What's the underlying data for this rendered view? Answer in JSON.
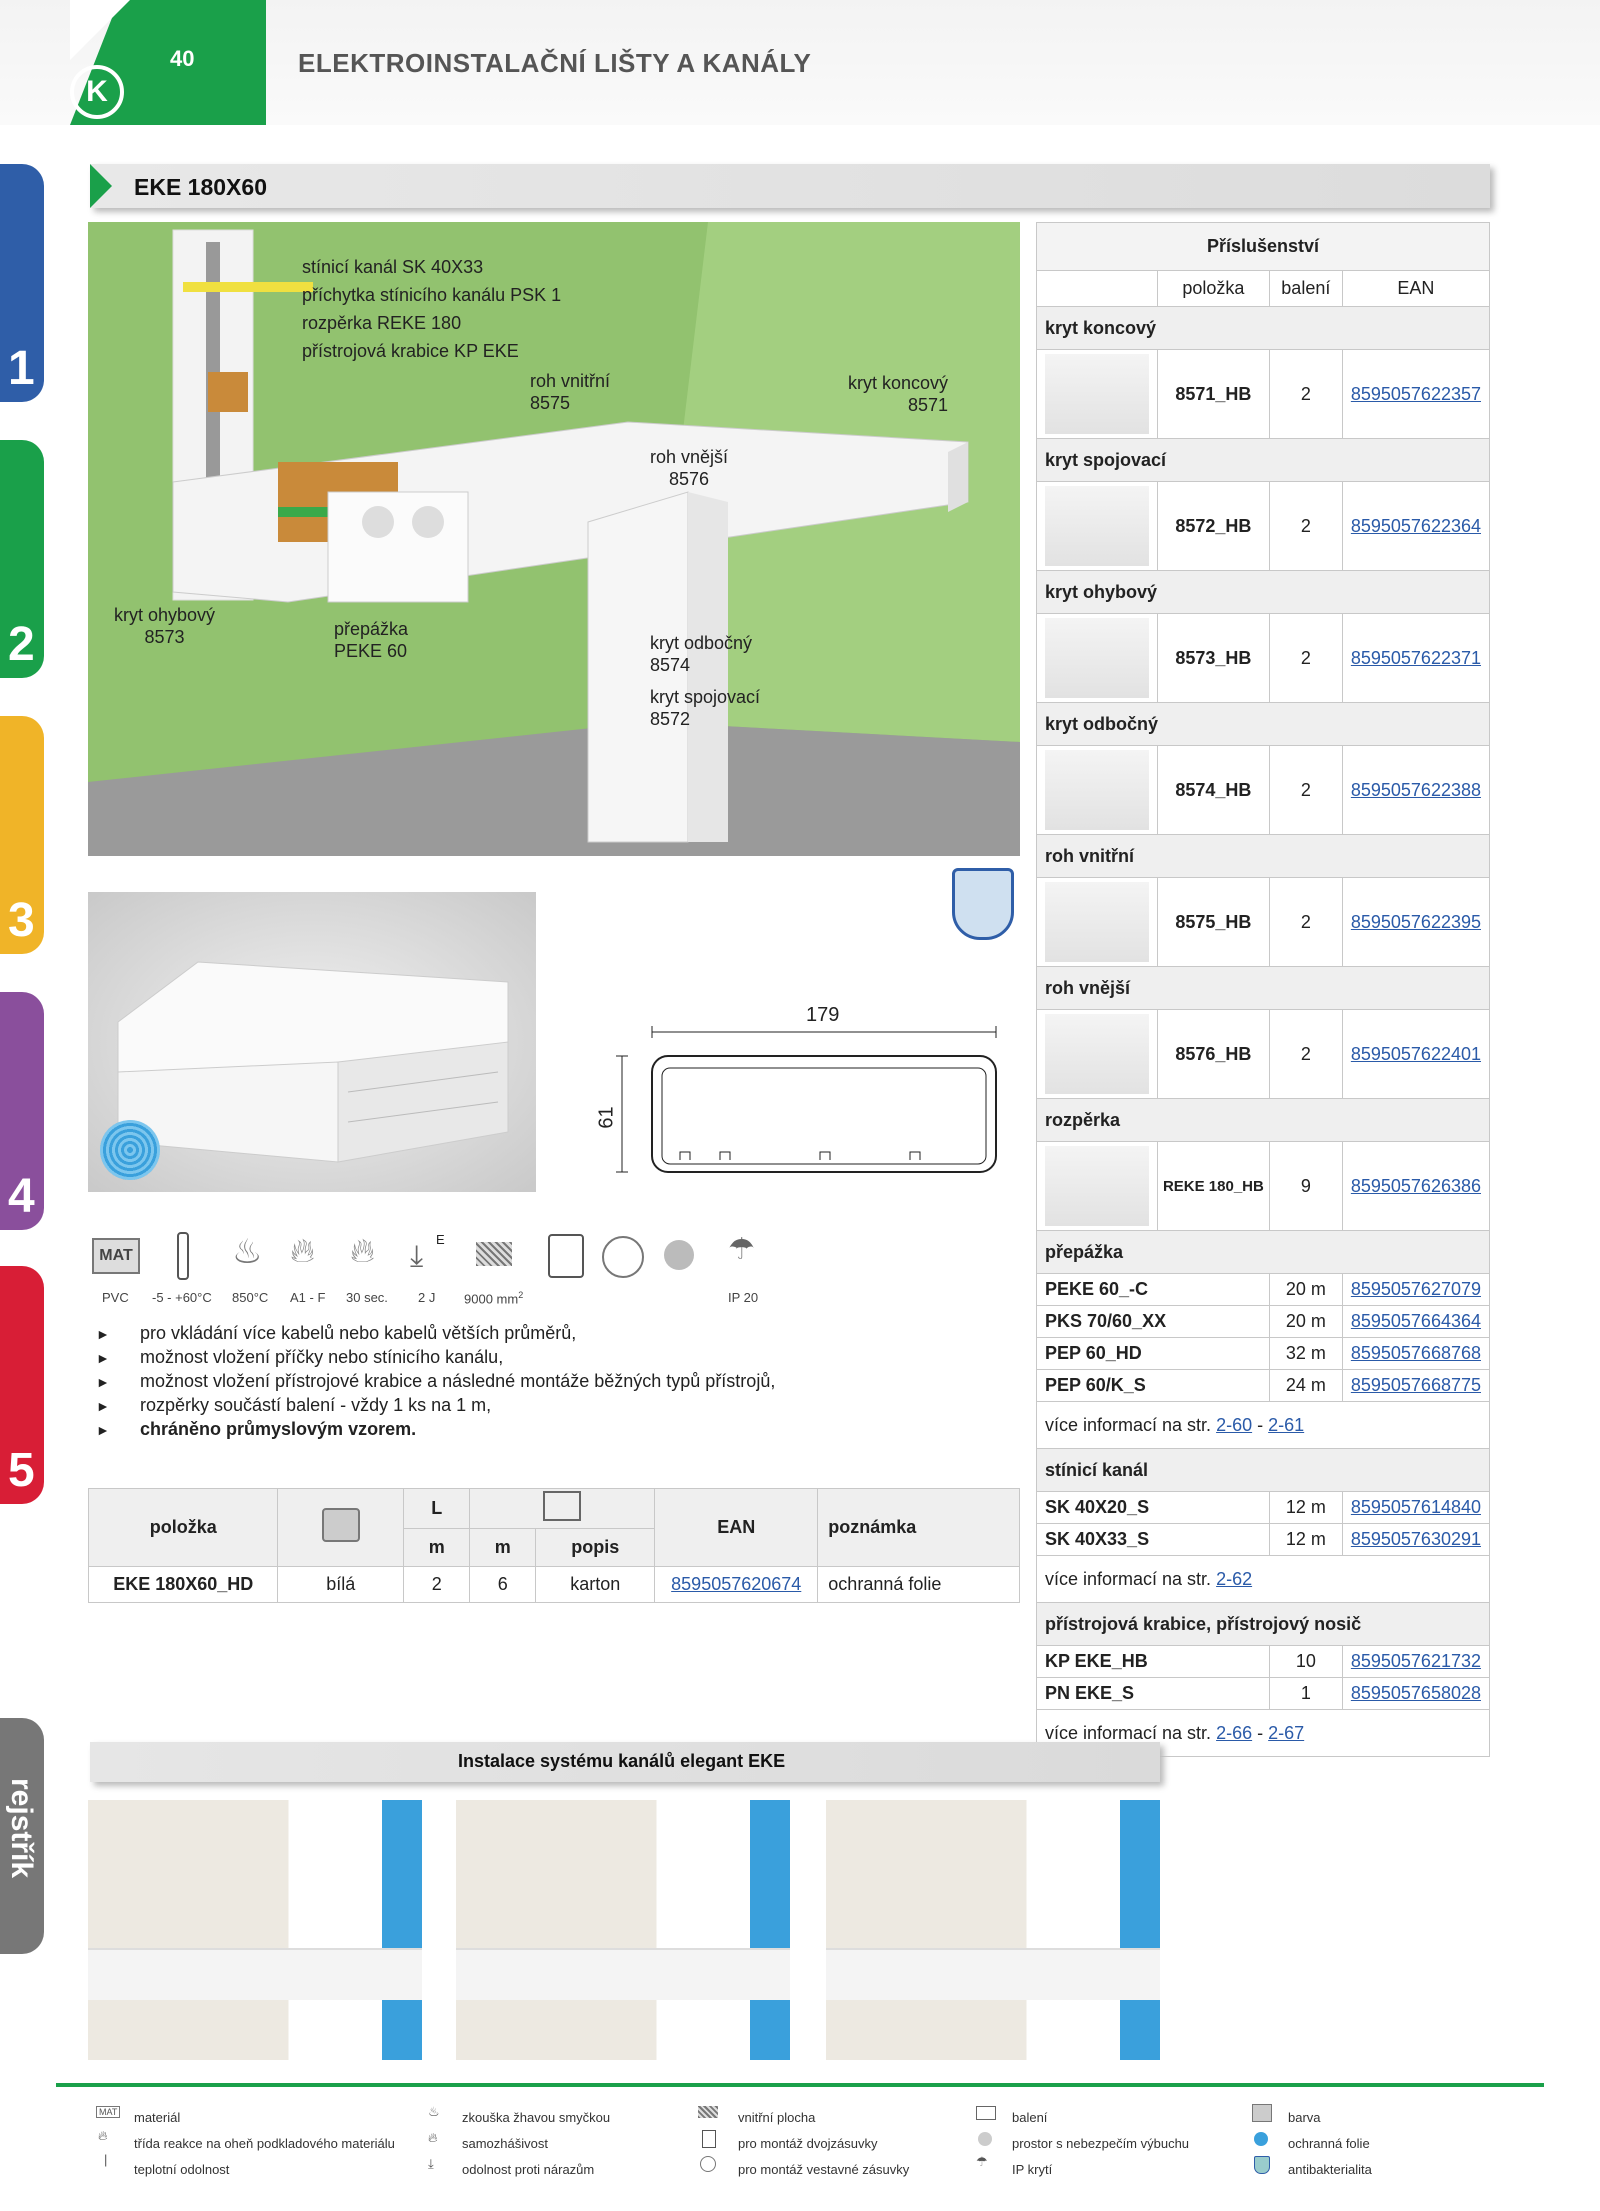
{
  "header": {
    "page_number": "40",
    "title": "ELEKTROINSTALAČNÍ LIŠTY A KANÁLY",
    "logo": "K"
  },
  "side_tabs": [
    "1",
    "2",
    "3",
    "4",
    "5"
  ],
  "side_tab_register": "rejstřík",
  "colors": {
    "green": "#1aa04a",
    "tab1": "#2f5ea8",
    "tab2": "#1aa04a",
    "tab3": "#f0b428",
    "tab4": "#8a4f9c",
    "tab5": "#d81e36"
  },
  "section_title": "EKE 180X60",
  "illustration_labels": {
    "l1": "stínicí kanál SK 40X33",
    "l2": "příchytka stínicího kanálu PSK 1",
    "l3": "rozpěrka REKE 180",
    "l4": "přístrojová krabice KP EKE",
    "roh_vnitrni": "roh vnitřní",
    "roh_vnitrni_no": "8575",
    "kryt_koncovy": "kryt koncový",
    "kryt_koncovy_no": "8571",
    "roh_vnejsi": "roh vnější",
    "roh_vnejsi_no": "8576",
    "kryt_ohybovy": "kryt ohybový",
    "kryt_ohybovy_no": "8573",
    "prepazka": "přepážka",
    "prepazka_no": "PEKE 60",
    "kryt_odbocny": "kryt odbočný",
    "kryt_odbocny_no": "8574",
    "kryt_spojovaci": "kryt spojovací",
    "kryt_spojovaci_no": "8572"
  },
  "dimensions": {
    "width": "179",
    "height": "61"
  },
  "icon_labels": {
    "material": "MAT",
    "pvc": "PVC",
    "temp": "-5 - +60°C",
    "glow": "850°C",
    "fire": "A1 - F",
    "fire_time": "30 sec.",
    "impact": "2 J",
    "impact_sup": "E",
    "area": "9000 mm",
    "area_sup": "2",
    "ip": "IP 20"
  },
  "bullets": [
    "pro vkládání více kabelů nebo kabelů větších průměrů,",
    "možnost vložení příčky nebo stínicího kanálu,",
    "možnost vložení přístrojové krabice a následné montáže běžných typů přístrojů,",
    "rozpěrky součástí balení - vždy 1 ks na 1 m,",
    "chráněno průmyslovým vzorem."
  ],
  "product_table": {
    "h_polozka": "položka",
    "h_L": "L",
    "h_m1": "m",
    "h_m2": "m",
    "h_popis": "popis",
    "h_ean": "EAN",
    "h_poznamka": "poznámka",
    "row": {
      "polozka": "EKE 180X60_HD",
      "barva": "bílá",
      "L": "2",
      "m": "6",
      "popis": "karton",
      "ean": "8595057620674",
      "poznamka": "ochranná folie"
    }
  },
  "accessories": {
    "title": "Příslušenství",
    "h_polozka": "položka",
    "h_baleni": "balení",
    "h_ean": "EAN",
    "groups": [
      {
        "name": "kryt koncový",
        "code": "8571_HB",
        "pack": "2",
        "ean": "8595057622357"
      },
      {
        "name": "kryt spojovací",
        "code": "8572_HB",
        "pack": "2",
        "ean": "8595057622364"
      },
      {
        "name": "kryt ohybový",
        "code": "8573_HB",
        "pack": "2",
        "ean": "8595057622371"
      },
      {
        "name": "kryt odbočný",
        "code": "8574_HB",
        "pack": "2",
        "ean": "8595057622388"
      },
      {
        "name": "roh vnitřní",
        "code": "8575_HB",
        "pack": "2",
        "ean": "8595057622395"
      },
      {
        "name": "roh vnější",
        "code": "8576_HB",
        "pack": "2",
        "ean": "8595057622401"
      },
      {
        "name": "rozpěrka",
        "code": "REKE 180_HB",
        "pack": "9",
        "ean": "8595057626386"
      }
    ],
    "prepazka": {
      "name": "přepážka",
      "rows": [
        {
          "code": "PEKE 60_-C",
          "pack": "20 m",
          "ean": "8595057627079"
        },
        {
          "code": "PKS 70/60_XX",
          "pack": "20 m",
          "ean": "8595057664364"
        },
        {
          "code": "PEP 60_HD",
          "pack": "32 m",
          "ean": "8595057668768"
        },
        {
          "code": "PEP 60/K_S",
          "pack": "24 m",
          "ean": "8595057668775"
        }
      ],
      "more": "více informací na str.",
      "ref1": "2-60",
      "dash": "-",
      "ref2": "2-61"
    },
    "stinici": {
      "name": "stínicí kanál",
      "rows": [
        {
          "code": "SK 40X20_S",
          "pack": "12 m",
          "ean": "8595057614840"
        },
        {
          "code": "SK 40X33_S",
          "pack": "12 m",
          "ean": "8595057630291"
        }
      ],
      "more": "více informací na str.",
      "ref1": "2-62"
    },
    "krabice": {
      "name": "přístrojová krabice, přístrojový nosič",
      "rows": [
        {
          "code": "KP EKE_HB",
          "pack": "10",
          "ean": "8595057621732"
        },
        {
          "code": "PN EKE_S",
          "pack": "1",
          "ean": "8595057658028"
        }
      ],
      "more": "více informací na str.",
      "ref1": "2-66",
      "dash": "-",
      "ref2": "2-67"
    }
  },
  "install_title": "Instalace systému kanálů elegant EKE",
  "legend": [
    [
      "materiál",
      "třída reakce na oheň podkladového materiálu",
      "teplotní odolnost"
    ],
    [
      "zkouška žhavou smyčkou",
      "samozhášivost",
      "odolnost proti nárazům"
    ],
    [
      "vnitřní plocha",
      "pro montáž dvojzásuvky",
      "pro montáž vestavné zásuvky"
    ],
    [
      "balení",
      "prostor s nebezpečím výbuchu",
      "IP krytí"
    ],
    [
      "barva",
      "ochranná folie",
      "antibakterialita"
    ]
  ],
  "legend_mat": "MAT"
}
